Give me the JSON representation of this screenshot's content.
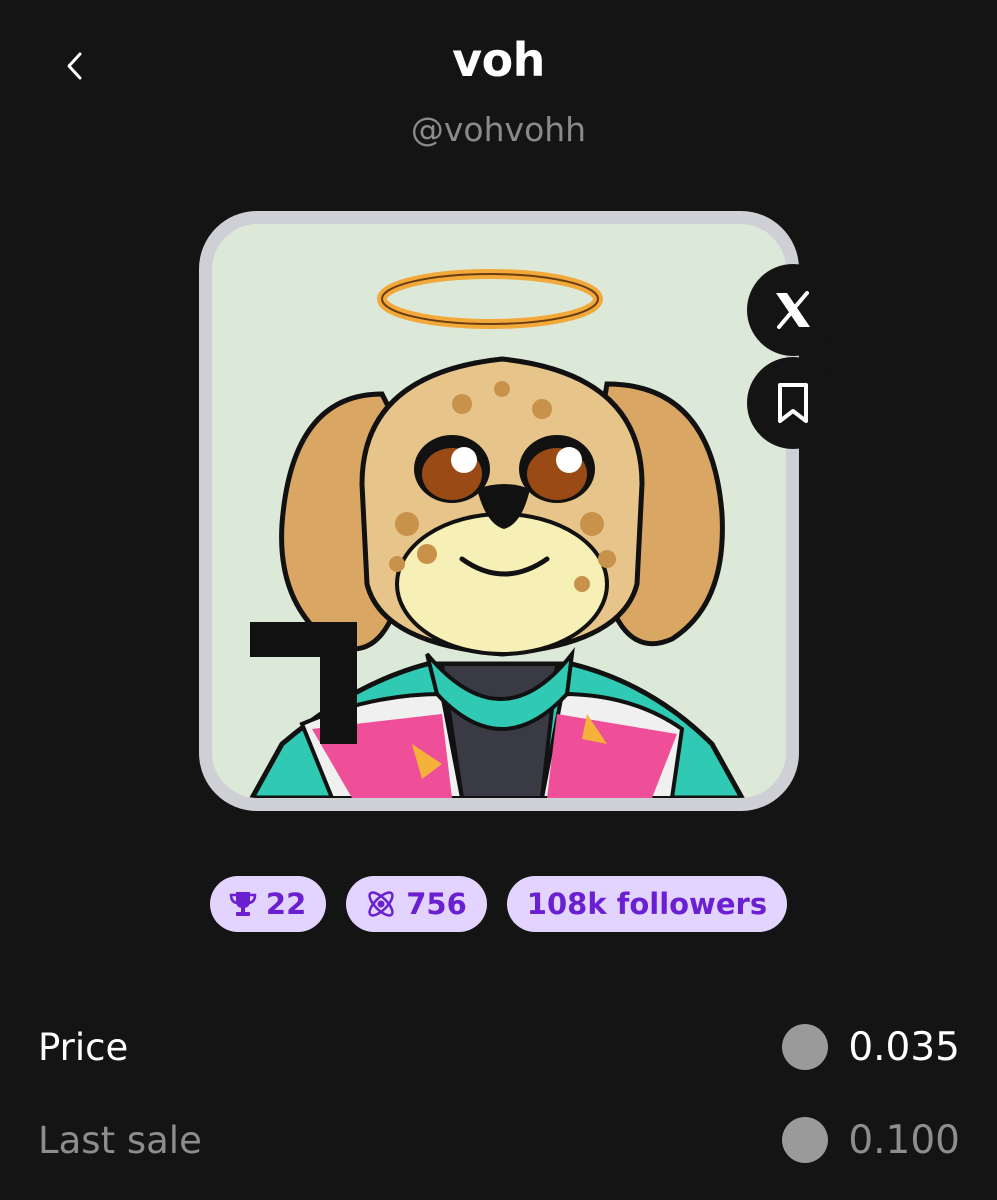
{
  "header": {
    "title": "voh",
    "handle": "@vohvohh",
    "back_icon": "chevron-left-icon"
  },
  "avatar": {
    "description_icon": "dog-avatar-with-halo",
    "frame_color": "#cfcfd6",
    "background_color": "#dde9d8"
  },
  "side_actions": {
    "x_icon": "x-logo-icon",
    "bookmark_icon": "bookmark-icon"
  },
  "stats": {
    "trophies": "22",
    "atoms": "756",
    "followers": "108k followers",
    "pill_bg": "#e2d4ff",
    "pill_fg": "#6a1fd1"
  },
  "price_rows": [
    {
      "label": "Price",
      "value": "0.035"
    },
    {
      "label": "Last sale",
      "value": "0.100"
    }
  ]
}
